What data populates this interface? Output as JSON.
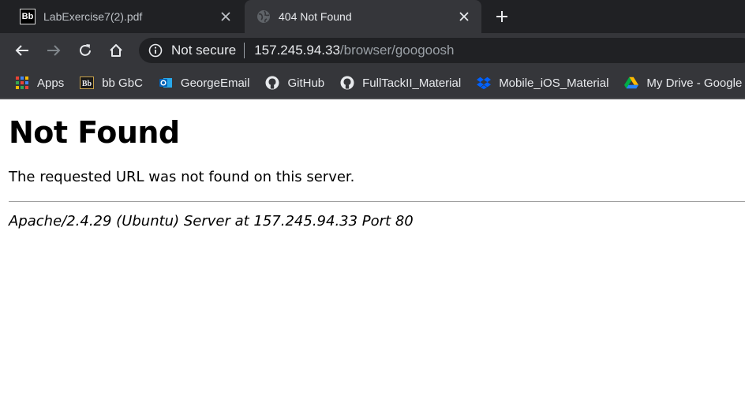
{
  "tabs": [
    {
      "title": "LabExercise7(2).pdf",
      "favicon": "bb-icon",
      "active": false
    },
    {
      "title": "404 Not Found",
      "favicon": "globe-icon",
      "active": true
    }
  ],
  "toolbar": {
    "security_label": "Not secure",
    "url_host": "157.245.94.33",
    "url_path": "/browser/googoosh"
  },
  "bookmarks": [
    {
      "label": "Apps",
      "icon": "apps-grid-icon"
    },
    {
      "label": "bb GbC",
      "icon": "bb-icon"
    },
    {
      "label": "GeorgeEmail",
      "icon": "outlook-icon"
    },
    {
      "label": "GitHub",
      "icon": "github-icon"
    },
    {
      "label": "FullTackII_Material",
      "icon": "github-icon"
    },
    {
      "label": "Mobile_iOS_Material",
      "icon": "dropbox-icon"
    },
    {
      "label": "My Drive - Google",
      "icon": "google-drive-icon"
    }
  ],
  "page": {
    "heading": "Not Found",
    "message": "The requested URL was not found on this server.",
    "server_signature": "Apache/2.4.29 (Ubuntu) Server at 157.245.94.33 Port 80"
  },
  "colors": {
    "tabstrip_bg": "#202124",
    "toolbar_bg": "#35363a",
    "omnibox_bg": "#202124",
    "text_light": "#e8eaed"
  }
}
